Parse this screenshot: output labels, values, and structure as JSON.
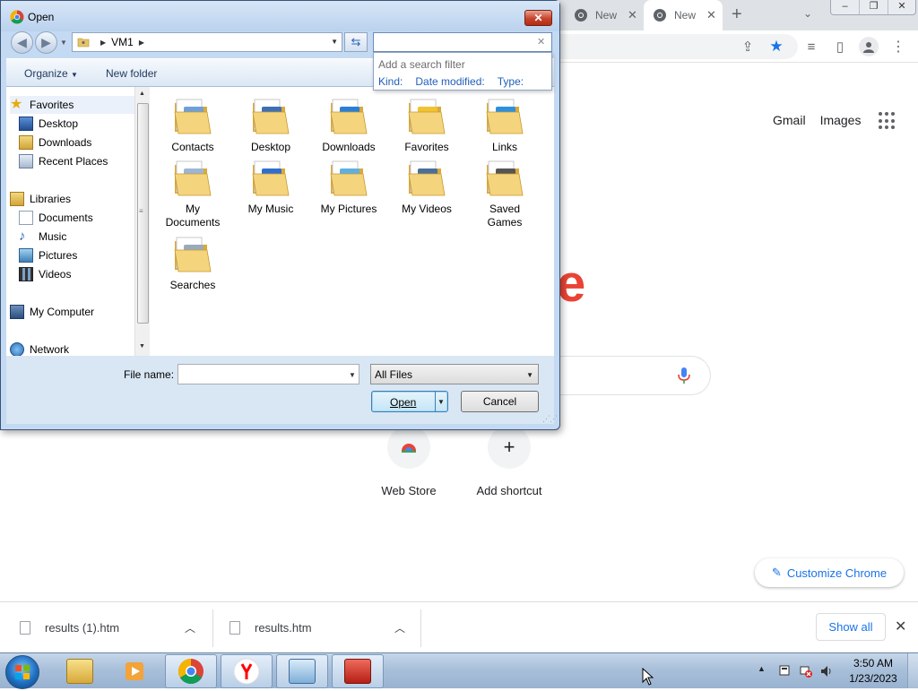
{
  "chrome": {
    "tabs": [
      {
        "label": "New"
      },
      {
        "label": "New"
      }
    ],
    "google_links": [
      "Gmail",
      "Images"
    ],
    "logo_fragment": "e",
    "shortcuts": [
      {
        "label": "Web Store"
      },
      {
        "label": "Add shortcut"
      }
    ],
    "customize_label": "Customize Chrome",
    "accent_color": "#1a73e8"
  },
  "downloads": {
    "items": [
      {
        "name": "results (1).htm"
      },
      {
        "name": "results.htm"
      }
    ],
    "show_all": "Show all"
  },
  "dialog": {
    "title": "Open",
    "address": {
      "path": "VM1"
    },
    "search": {
      "value": "",
      "filter_hint": "Add a search filter",
      "filters": [
        "Kind:",
        "Date modified:",
        "Type:"
      ]
    },
    "toolbar": {
      "organize": "Organize",
      "new_folder": "New folder"
    },
    "nav": {
      "favorites": "Favorites",
      "favorites_items": [
        "Desktop",
        "Downloads",
        "Recent Places"
      ],
      "libraries": "Libraries",
      "libraries_items": [
        "Documents",
        "Music",
        "Pictures",
        "Videos"
      ],
      "computer": "My Computer",
      "network": "Network"
    },
    "folders": [
      {
        "name": "Contacts"
      },
      {
        "name": "Desktop"
      },
      {
        "name": "Downloads"
      },
      {
        "name": "Favorites"
      },
      {
        "name": "Links"
      },
      {
        "name": "My Documents"
      },
      {
        "name": "My Music"
      },
      {
        "name": "My Pictures"
      },
      {
        "name": "My Videos"
      },
      {
        "name": "Saved Games"
      },
      {
        "name": "Searches"
      }
    ],
    "file_name_label": "File name:",
    "file_name_value": "",
    "file_type": "All Files",
    "open_label": "Open",
    "cancel_label": "Cancel"
  },
  "taskbar": {
    "clock_time": "3:50 AM",
    "clock_date": "1/23/2023"
  }
}
